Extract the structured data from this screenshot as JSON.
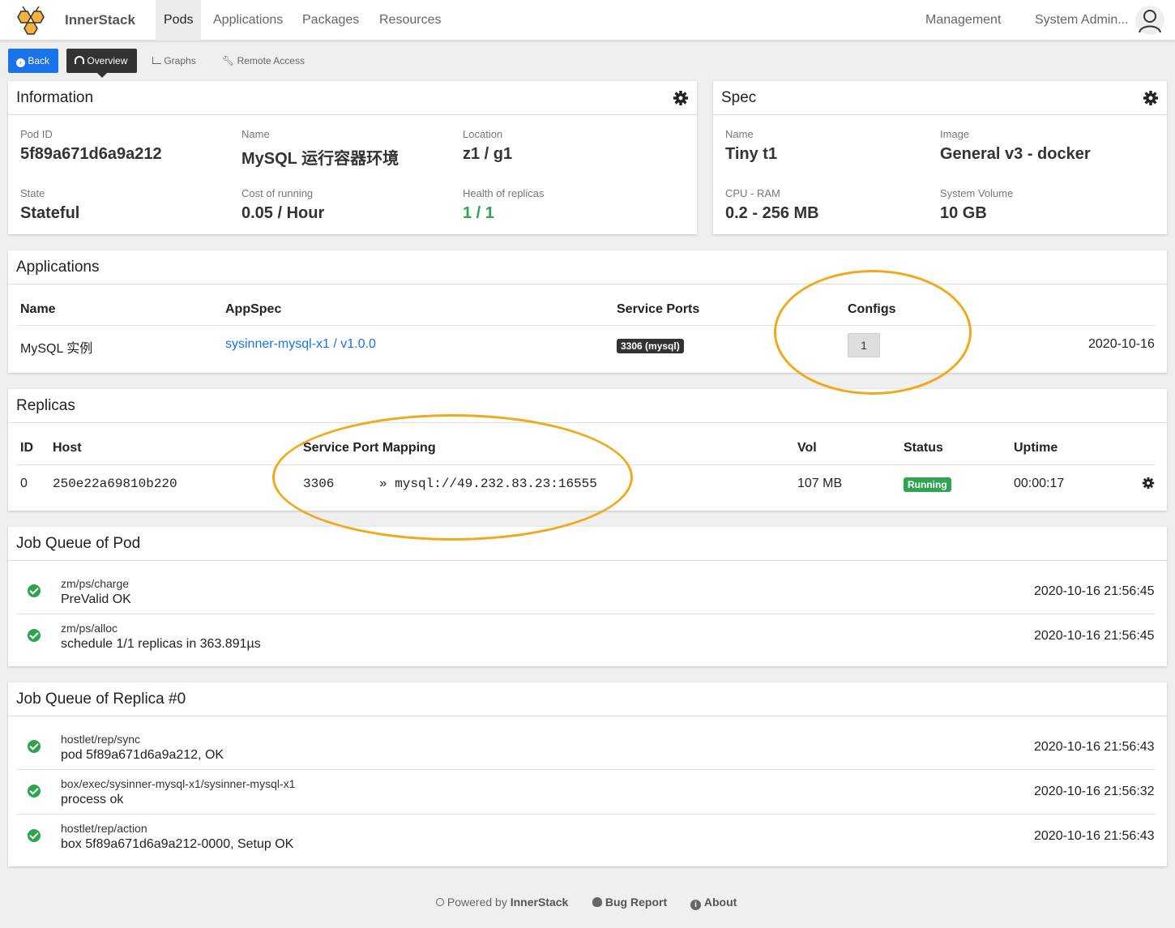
{
  "nav": {
    "brand": "InnerStack",
    "items": [
      "Pods",
      "Applications",
      "Packages",
      "Resources"
    ],
    "management": "Management",
    "user": "System Admin..."
  },
  "subnav": {
    "back": "Back",
    "overview": "Overview",
    "graphs": "Graphs",
    "remote_access": "Remote Access"
  },
  "information": {
    "title": "Information",
    "pod_id_label": "Pod ID",
    "pod_id": "5f89a671d6a9a212",
    "name_label": "Name",
    "name": "MySQL 运行容器环境",
    "location_label": "Location",
    "location": "z1 / g1",
    "state_label": "State",
    "state": "Stateful",
    "cost_label": "Cost of running",
    "cost": "0.05 / Hour",
    "health_label": "Health of replicas",
    "health": "1 / 1"
  },
  "spec": {
    "title": "Spec",
    "name_label": "Name",
    "name": "Tiny t1",
    "image_label": "Image",
    "image": "General v3 - docker",
    "cpu_label": "CPU - RAM",
    "cpu": "0.2 - 256 MB",
    "volume_label": "System Volume",
    "volume": "10 GB"
  },
  "applications": {
    "title": "Applications",
    "headers": {
      "name": "Name",
      "appspec": "AppSpec",
      "ports": "Service Ports",
      "configs": "Configs"
    },
    "row": {
      "name": "MySQL 实例",
      "appspec": "sysinner-mysql-x1 / v1.0.0",
      "port": "3306 (mysql)",
      "configs": "1",
      "date": "2020-10-16"
    }
  },
  "replicas": {
    "title": "Replicas",
    "headers": {
      "id": "ID",
      "host": "Host",
      "mapping": "Service Port Mapping",
      "vol": "Vol",
      "status": "Status",
      "uptime": "Uptime"
    },
    "row": {
      "id": "0",
      "host": "250e22a69810b220",
      "port": "3306",
      "target": "» mysql://49.232.83.23:16555",
      "vol": "107 MB",
      "status": "Running",
      "uptime": "00:00:17"
    }
  },
  "job_queue_pod": {
    "title": "Job Queue of Pod",
    "items": [
      {
        "path": "zm/ps/charge",
        "msg": "PreValid OK",
        "time": "2020-10-16 21:56:45"
      },
      {
        "path": "zm/ps/alloc",
        "msg": "schedule 1/1 replicas in 363.891µs",
        "time": "2020-10-16 21:56:45"
      }
    ]
  },
  "job_queue_replica": {
    "title": "Job Queue of Replica #0",
    "items": [
      {
        "path": "hostlet/rep/sync",
        "msg": "pod 5f89a671d6a9a212, OK",
        "time": "2020-10-16 21:56:43"
      },
      {
        "path": "box/exec/sysinner-mysql-x1/sysinner-mysql-x1",
        "msg": "process ok",
        "time": "2020-10-16 21:56:32"
      },
      {
        "path": "hostlet/rep/action",
        "msg": "box 5f89a671d6a9a212-0000, Setup OK",
        "time": "2020-10-16 21:56:43"
      }
    ]
  },
  "footer": {
    "powered": "Powered by",
    "brand": "InnerStack",
    "bug": "Bug Report",
    "about": "About"
  },
  "colors": {
    "accent": "#1a73e8",
    "success": "#2ea44f",
    "highlight": "#f0a91b",
    "brand_hex": "#f3b23e"
  }
}
